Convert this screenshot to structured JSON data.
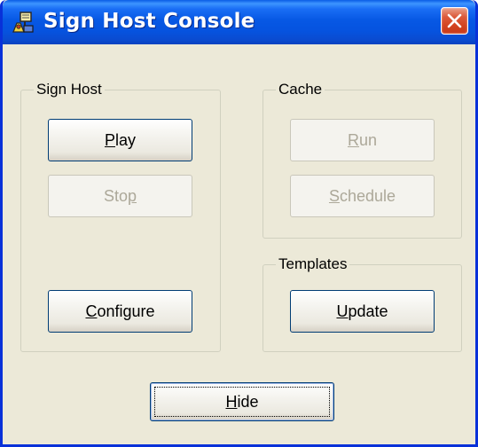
{
  "window": {
    "title": "Sign Host Console",
    "icon": "sign-host-app-icon",
    "close_icon": "close-x-icon"
  },
  "groups": {
    "sign_host": {
      "label": "Sign Host",
      "buttons": [
        {
          "mnemonic": "P",
          "rest": "lay",
          "enabled": true
        },
        {
          "pre": "Sto",
          "mnemonic": "p",
          "rest": "",
          "enabled": false
        },
        {
          "mnemonic": "C",
          "rest": "onfigure",
          "enabled": true
        }
      ]
    },
    "cache": {
      "label": "Cache",
      "buttons": [
        {
          "mnemonic": "R",
          "rest": "un",
          "enabled": false
        },
        {
          "mnemonic": "S",
          "rest": "chedule",
          "enabled": false
        }
      ]
    },
    "templates": {
      "label": "Templates",
      "buttons": [
        {
          "mnemonic": "U",
          "rest": "pdate",
          "enabled": true
        }
      ]
    }
  },
  "footer": {
    "hide": {
      "mnemonic": "H",
      "rest": "ide",
      "enabled": true
    }
  },
  "colors": {
    "titlebar": "#0758e4",
    "close_button": "#d2431f",
    "dialog_background": "#ece9d8",
    "disabled_text": "#aca899"
  }
}
